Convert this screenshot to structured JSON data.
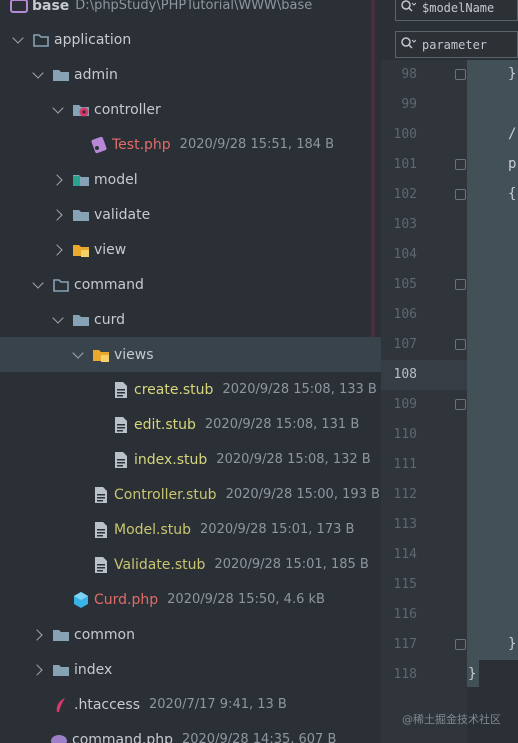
{
  "project_tree": {
    "rows": [
      {
        "name": "base",
        "meta": "D:\\phpStudy\\PHPTutorial\\WWW\\base"
      },
      {
        "name": "application",
        "meta": ""
      },
      {
        "name": "admin",
        "meta": ""
      },
      {
        "name": "controller",
        "meta": ""
      },
      {
        "name": "Test.php",
        "meta": "2020/9/28 15:51, 184 B"
      },
      {
        "name": "model",
        "meta": ""
      },
      {
        "name": "validate",
        "meta": ""
      },
      {
        "name": "view",
        "meta": ""
      },
      {
        "name": "command",
        "meta": ""
      },
      {
        "name": "curd",
        "meta": ""
      },
      {
        "name": "views",
        "meta": ""
      },
      {
        "name": "create.stub",
        "meta": "2020/9/28 15:08, 133 B"
      },
      {
        "name": "edit.stub",
        "meta": "2020/9/28 15:08, 131 B"
      },
      {
        "name": "index.stub",
        "meta": "2020/9/28 15:08, 132 B"
      },
      {
        "name": "Controller.stub",
        "meta": "2020/9/28 15:00, 193 B"
      },
      {
        "name": "Model.stub",
        "meta": "2020/9/28 15:01, 173 B"
      },
      {
        "name": "Validate.stub",
        "meta": "2020/9/28 15:01, 185 B"
      },
      {
        "name": "Curd.php",
        "meta": "2020/9/28 15:50, 4.6 kB"
      },
      {
        "name": "common",
        "meta": ""
      },
      {
        "name": "index",
        "meta": ""
      },
      {
        "name": ".htaccess",
        "meta": "2020/7/17 9:41, 13 B"
      },
      {
        "name": "command.php",
        "meta": "2020/9/28 14:35, 607 B"
      }
    ]
  },
  "editor": {
    "search_fields": [
      "$modelName",
      "parameter"
    ],
    "line_numbers": [
      "98",
      "99",
      "100",
      "101",
      "102",
      "103",
      "104",
      "105",
      "106",
      "107",
      "108",
      "109",
      "110",
      "111",
      "112",
      "113",
      "114",
      "115",
      "116",
      "117",
      "118"
    ],
    "code_fragments": {
      "l98": "}",
      "l100": "/",
      "l101": "p",
      "l102": "{",
      "l117": "}",
      "l118": "}"
    }
  },
  "watermark": "@稀土掘金技术社区",
  "colors": {
    "background": "#2b3036",
    "selected_row": "#39434c",
    "php_red": "#e06c68",
    "stub_yellow": "#d7d67d",
    "folder": "#87a1b5",
    "accent": "#4a2e3b"
  }
}
